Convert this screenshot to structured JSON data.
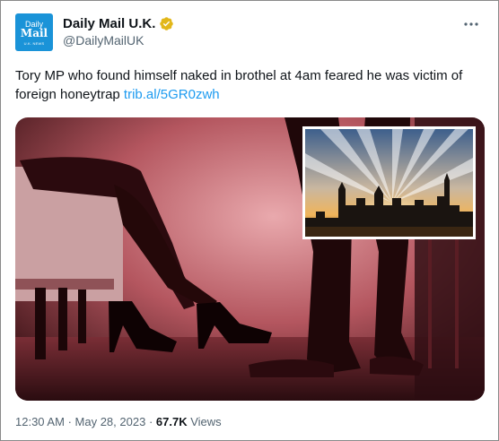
{
  "account": {
    "avatar_line1": "Daily",
    "avatar_line2": "Mail",
    "avatar_line3": "U.K. NEWS",
    "display_name": "Daily Mail U.K.",
    "handle": "@DailyMailUK",
    "verified_color": "#e2b719"
  },
  "tweet": {
    "text": "Tory MP who found himself naked in brothel at 4am feared he was victim of foreign honeytrap",
    "link": "trib.al/5GR0zwh"
  },
  "media": {
    "image_description_icon": "photo-icon",
    "inset_icon": "parliament-sunset-photo"
  },
  "meta": {
    "time": "12:30 AM",
    "date": "May 28, 2023",
    "separator": "·",
    "views_count": "67.7K",
    "views_label": "Views"
  },
  "colors": {
    "link": "#1d9bf0",
    "secondary_text": "#536471",
    "avatar_bg": "#1a93d8"
  }
}
